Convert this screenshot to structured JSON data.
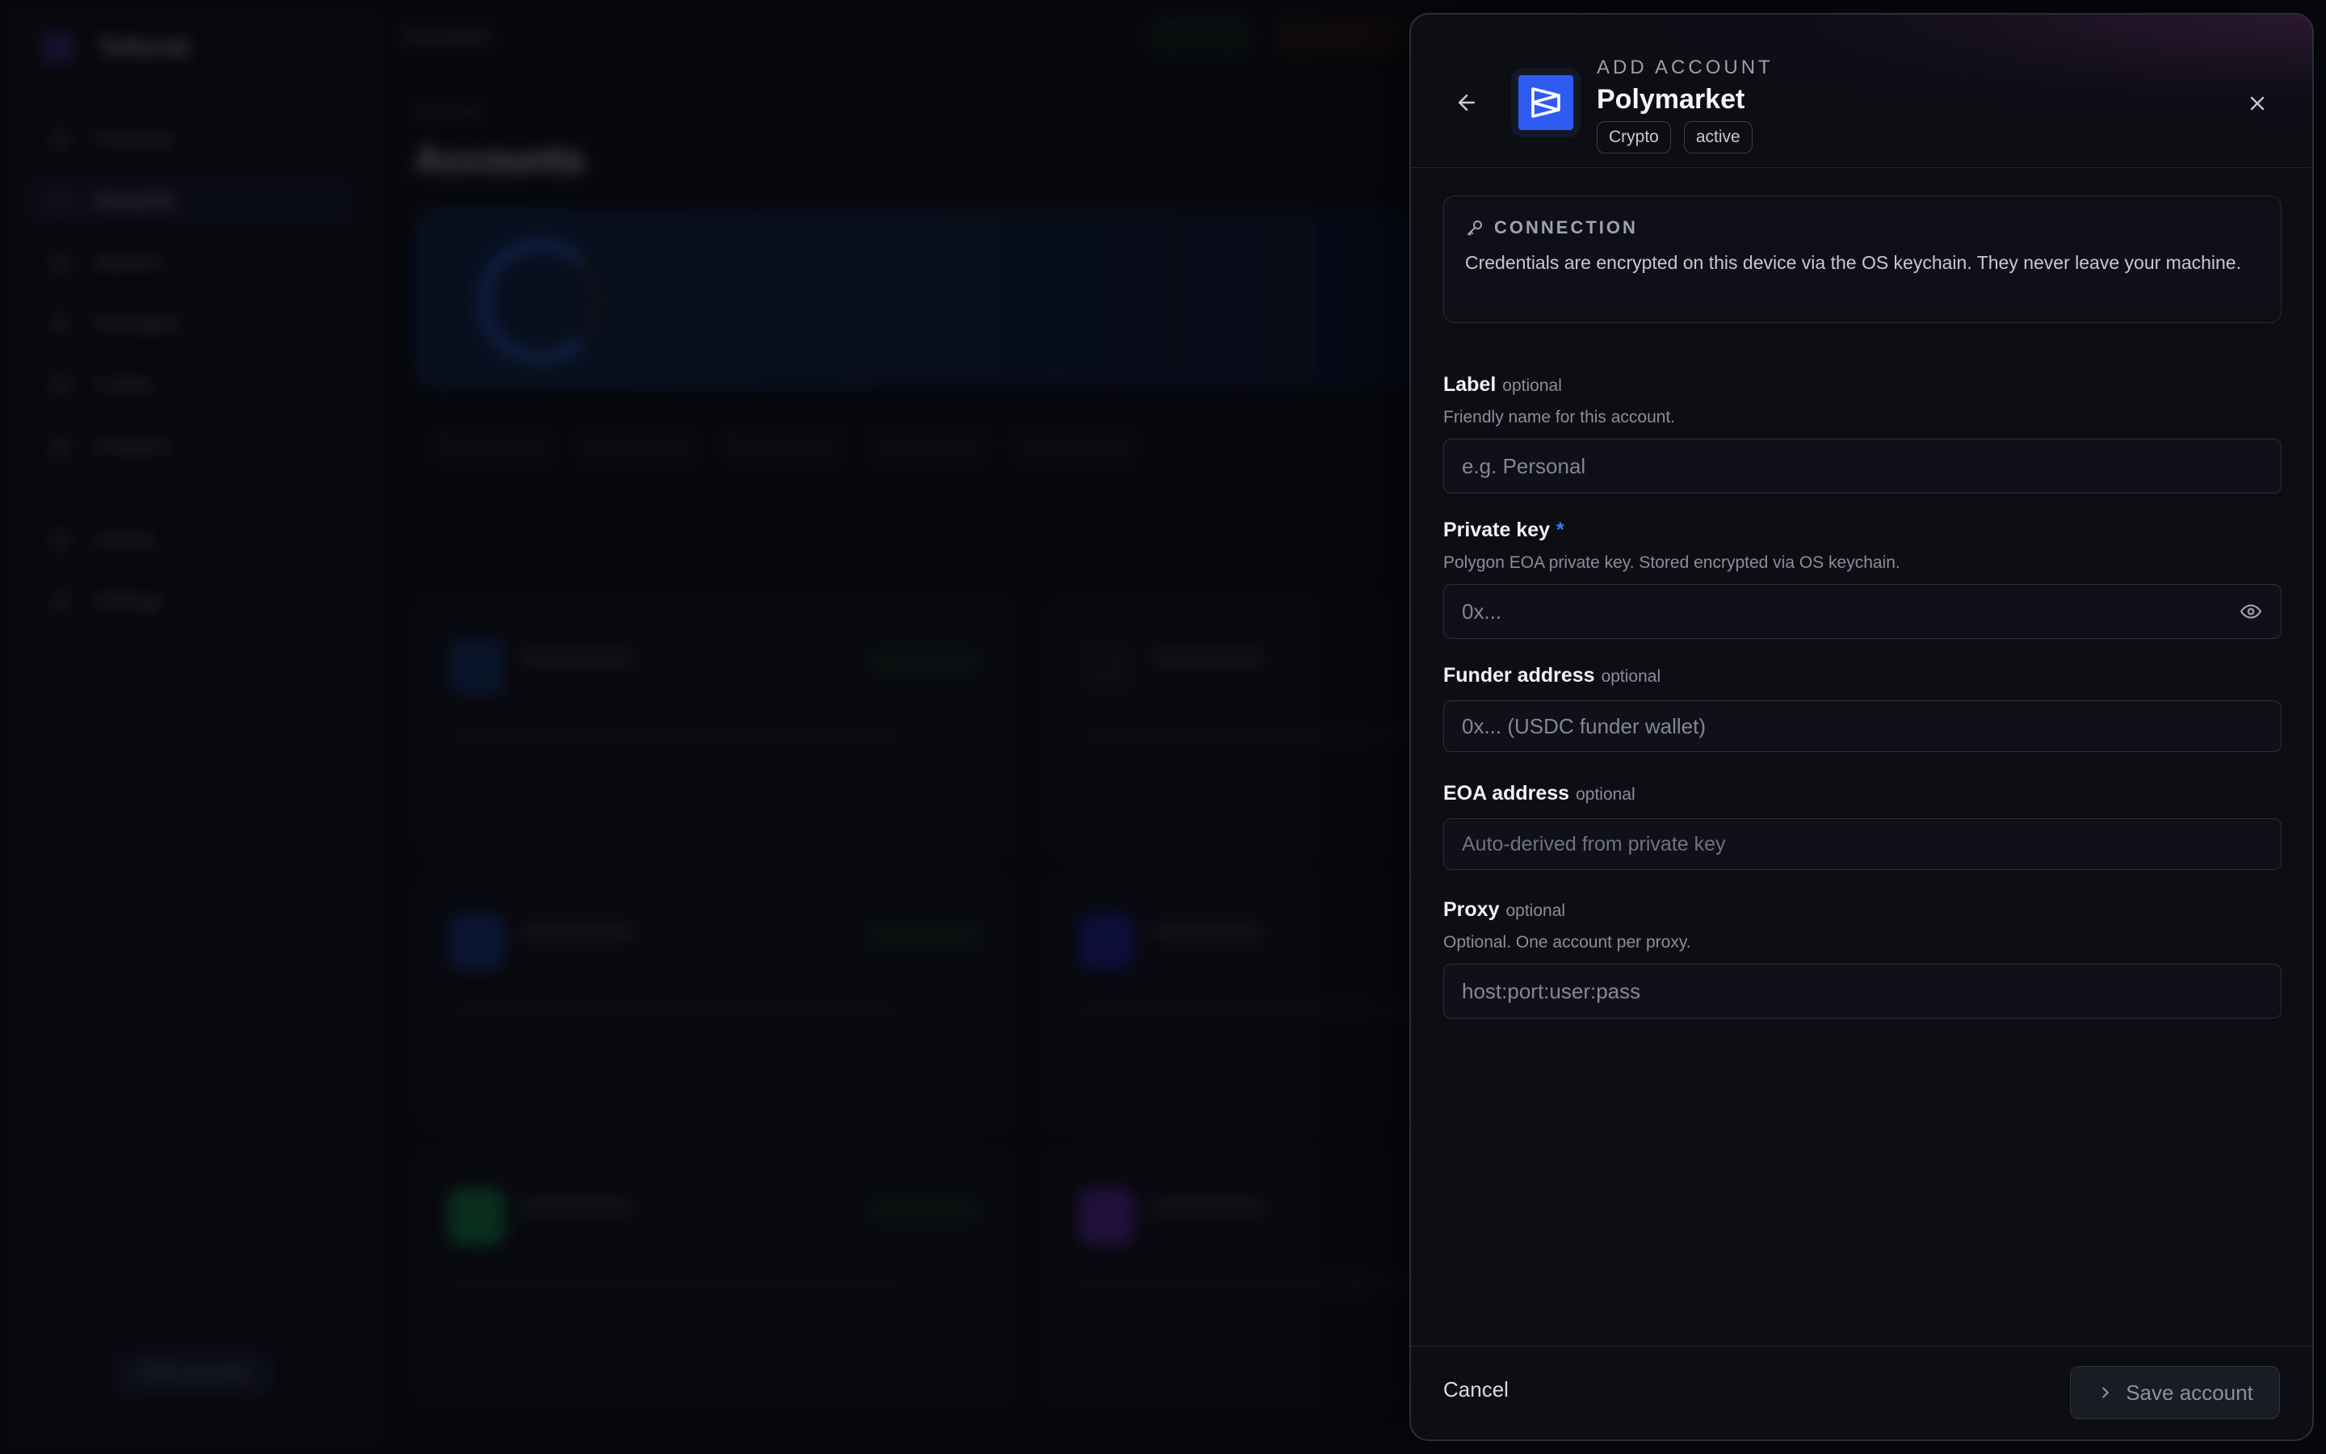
{
  "background_app": {
    "brand_name": "Tellurial",
    "page_subtitle": "Overview",
    "page_title": "Accounts",
    "breadcrumb": "Accounts",
    "nav_items": [
      "Overview",
      "Accounts",
      "Markets",
      "Strategies",
      "Trades",
      "Analytics",
      "Activity",
      "Settings"
    ],
    "footer_button": "Add account"
  },
  "drawer": {
    "eyebrow": "ADD ACCOUNT",
    "title": "Polymarket",
    "tags": [
      "Crypto",
      "active"
    ],
    "connection": {
      "heading": "CONNECTION",
      "text": "Credentials are encrypted on this device via the OS keychain. They never leave your machine."
    },
    "fields": {
      "label": {
        "label": "Label",
        "optional": "optional",
        "help": "Friendly name for this account.",
        "placeholder": "e.g. Personal"
      },
      "private_key": {
        "label": "Private key",
        "required_mark": "*",
        "help": "Polygon EOA private key. Stored encrypted via OS keychain.",
        "placeholder": "0x..."
      },
      "funder_address": {
        "label": "Funder address",
        "optional": "optional",
        "placeholder": "0x... (USDC funder wallet)"
      },
      "eoa_address": {
        "label": "EOA address",
        "optional": "optional",
        "placeholder": "Auto-derived from private key"
      },
      "proxy": {
        "label": "Proxy",
        "optional": "optional",
        "help": "Optional. One account per proxy.",
        "placeholder": "host:port:user:pass"
      }
    },
    "footer": {
      "cancel_label": "Cancel",
      "save_label": "Save account"
    }
  },
  "colors": {
    "accent": "#3b7cf6",
    "logo_blue": "#2f5bf0",
    "panel_bg": "#0d0e14"
  }
}
